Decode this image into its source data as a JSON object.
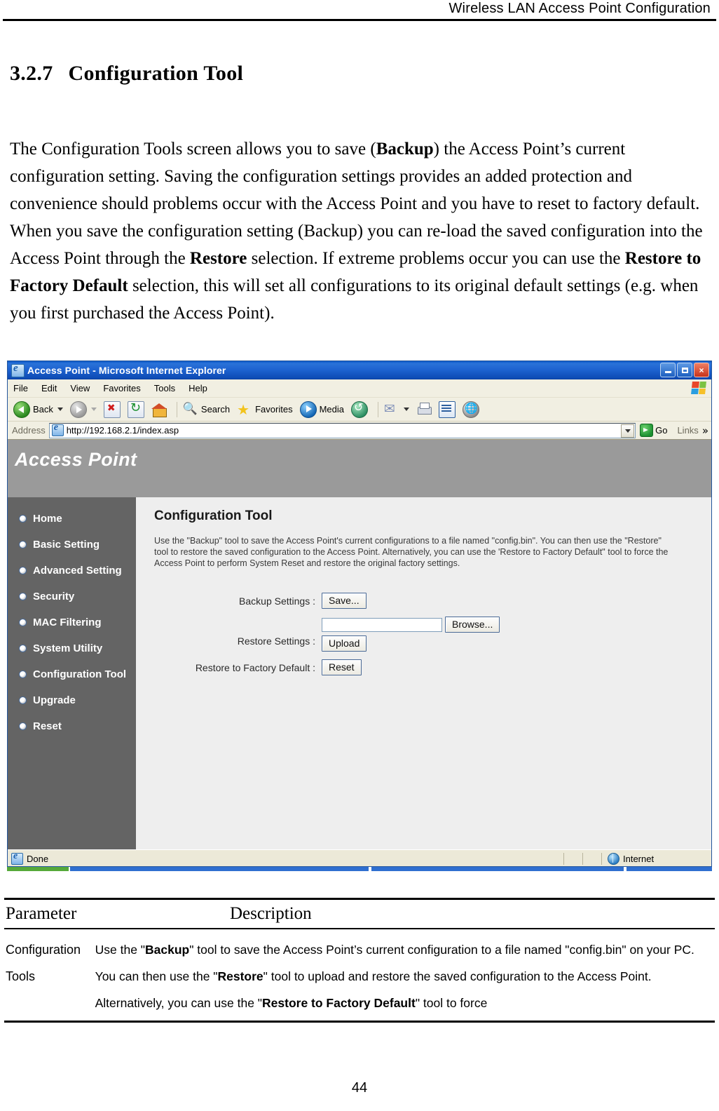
{
  "page": {
    "running_header": "Wireless LAN Access Point Configuration",
    "section_number": "3.2.7",
    "section_title": "Configuration Tool",
    "page_number": "44",
    "intro_paragraph": {
      "part1": "The Configuration Tools screen allows you to save (",
      "bold1": "Backup",
      "part2": ") the Access Point’s current configuration setting. Saving the configuration settings provides an added protection and convenience should problems occur with the Access Point and you have to reset to factory default. When you save the configuration setting (Backup) you can re-load the saved configuration into the Access Point through the ",
      "bold2": "Restore",
      "part3": " selection. If extreme problems occur you can use the ",
      "bold3": "Restore to Factory Default",
      "part4": " selection, this will set all configurations to its original default settings (e.g. when you first purchased the Access Point)."
    }
  },
  "browser": {
    "title": "Access Point - Microsoft Internet Explorer",
    "window_buttons": {
      "minimize": "minimize-button",
      "maximize": "restore-button",
      "close": "×"
    },
    "menu": [
      "File",
      "Edit",
      "View",
      "Favorites",
      "Tools",
      "Help"
    ],
    "toolbar": {
      "back": "Back",
      "forward": "",
      "stop": "",
      "refresh": "",
      "home": "",
      "search": "Search",
      "favorites": "Favorites",
      "media": "Media",
      "history": "",
      "mail": "",
      "print": "",
      "edit": "",
      "discuss": ""
    },
    "address": {
      "label": "Address",
      "url": "http://192.168.2.1/index.asp",
      "go_label": "Go",
      "links_label": "Links",
      "chevron": "»"
    },
    "status": {
      "text": "Done",
      "zone": "Internet"
    }
  },
  "webpage": {
    "banner_title": "Access Point",
    "sidebar": {
      "items": [
        {
          "label": "Home"
        },
        {
          "label": "Basic Setting"
        },
        {
          "label": "Advanced Setting"
        },
        {
          "label": "Security"
        },
        {
          "label": "MAC Filtering"
        },
        {
          "label": "System Utility"
        },
        {
          "label": "Configuration Tool"
        },
        {
          "label": "Upgrade"
        },
        {
          "label": "Reset"
        }
      ]
    },
    "main": {
      "title": "Configuration Tool",
      "description": "Use the \"Backup\" tool to save the Access Point's current configurations to a file named \"config.bin\". You can then use the \"Restore\" tool to restore the saved configuration to the Access Point. Alternatively, you can use the 'Restore to Factory Default\" tool to force the Access Point to perform System Reset and restore the original factory settings.",
      "form": {
        "backup_label": "Backup Settings :",
        "backup_button": "Save...",
        "restore_label": "Restore Settings :",
        "restore_file_value": "",
        "browse_button": "Browse...",
        "upload_button": "Upload",
        "factory_label": "Restore to Factory Default :",
        "reset_button": "Reset"
      }
    }
  },
  "param_table": {
    "headers": {
      "parameter": "Parameter",
      "description": "Description"
    },
    "row": {
      "parameter": "Configuration Tools",
      "desc_a": "Use the \"",
      "desc_b1": "Backup",
      "desc_c": "\" tool to save the Access Point’s current configuration to a file named \"config.bin\" on your PC. You can then use the \"",
      "desc_b2": "Restore",
      "desc_d": "\" tool to upload and restore the saved configuration to the Access Point. Alternatively, you can use the \"",
      "desc_b3": "Restore to Factory Default",
      "desc_e": "\" tool to force"
    }
  },
  "colors": {
    "banner_gray": "#9a9a9a",
    "sidebar_gray": "#646464",
    "content_gray": "#eeeeee",
    "titlebar_blue": "#1d62cf",
    "chrome_beige": "#ece9d8"
  }
}
